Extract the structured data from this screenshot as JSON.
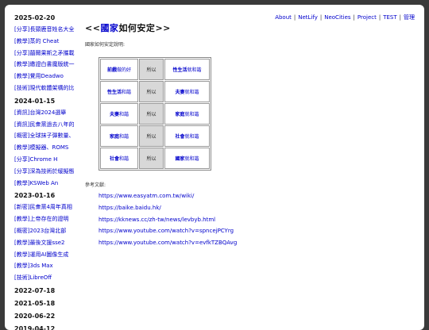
{
  "sidebar": {
    "sections": [
      {
        "date": "2025-02-20",
        "items": [
          "[分享]長頸鹿音姓名大全",
          "[教學]蒸的 Cheat",
          "[分享]囍爾果斯之矛攜載",
          "[教學]繳證白書魔版統一",
          "[教學]覺用Deadwo",
          "[技術]現代軟體架構的比"
        ]
      },
      {
        "date": "2024-01-15",
        "items": [
          "[資訊]台灣2024選舉",
          "[資訊]民衆黨過去八年的",
          "[概密]全球抹子彈數量、",
          "[教學]模擬器、ROMS",
          "[分享]Chrome H",
          "[分享]深為技術於緩擬態",
          "[教學]KSWeb An"
        ]
      },
      {
        "date": "2023-01-16",
        "items": [
          "[新密]民衆黨4周年真相",
          "[教學]上帝存在的證明",
          "[概密]2023台灣北部",
          "[教學]最後文援sse2",
          "[教學]運用AI圖像生成",
          "[教學]3ds Max",
          "[技術]LibreOff"
        ]
      },
      {
        "date": "2022-07-18",
        "items": []
      },
      {
        "date": "2021-05-18",
        "items": []
      },
      {
        "date": "2020-06-22",
        "items": []
      },
      {
        "date": "2019-04-12",
        "items": []
      }
    ]
  },
  "topnav": {
    "links": [
      "About",
      "NetLify",
      "NeoCities",
      "Project",
      "TEST",
      "管理"
    ]
  },
  "main": {
    "title_prefix": "<<",
    "title_link": "國家",
    "title_rest": "如何安定",
    "title_suffix": ">>",
    "intro": "國家如何安定說明:",
    "grid": [
      {
        "a_bold": "前戲",
        "a_rest": "做的好",
        "mid": "所以",
        "b_bold": "性生活",
        "b_rest": "就和諧"
      },
      {
        "a_bold": "性生活",
        "a_rest": "和諧",
        "mid": "所以",
        "b_bold": "夫妻",
        "b_rest": "就和諧"
      },
      {
        "a_bold": "夫妻",
        "a_rest": "和諧",
        "mid": "所以",
        "b_bold": "家庭",
        "b_rest": "就和諧"
      },
      {
        "a_bold": "家庭",
        "a_rest": "和諧",
        "mid": "所以",
        "b_bold": "社會",
        "b_rest": "就和諧"
      },
      {
        "a_bold": "社會",
        "a_rest": "和諧",
        "mid": "所以",
        "b_bold": "國家",
        "b_rest": "就和諧"
      }
    ],
    "refs_label": "參考文獻:",
    "refs": [
      "https://www.easyatm.com.tw/wiki/",
      "https://baike.baidu.hk/",
      "https://kknews.cc/zh-tw/news/levbyb.html",
      "https://www.youtube.com/watch?v=spncejPCYrg",
      "https://www.youtube.com/watch?v=evfkTZBQAvg"
    ]
  }
}
